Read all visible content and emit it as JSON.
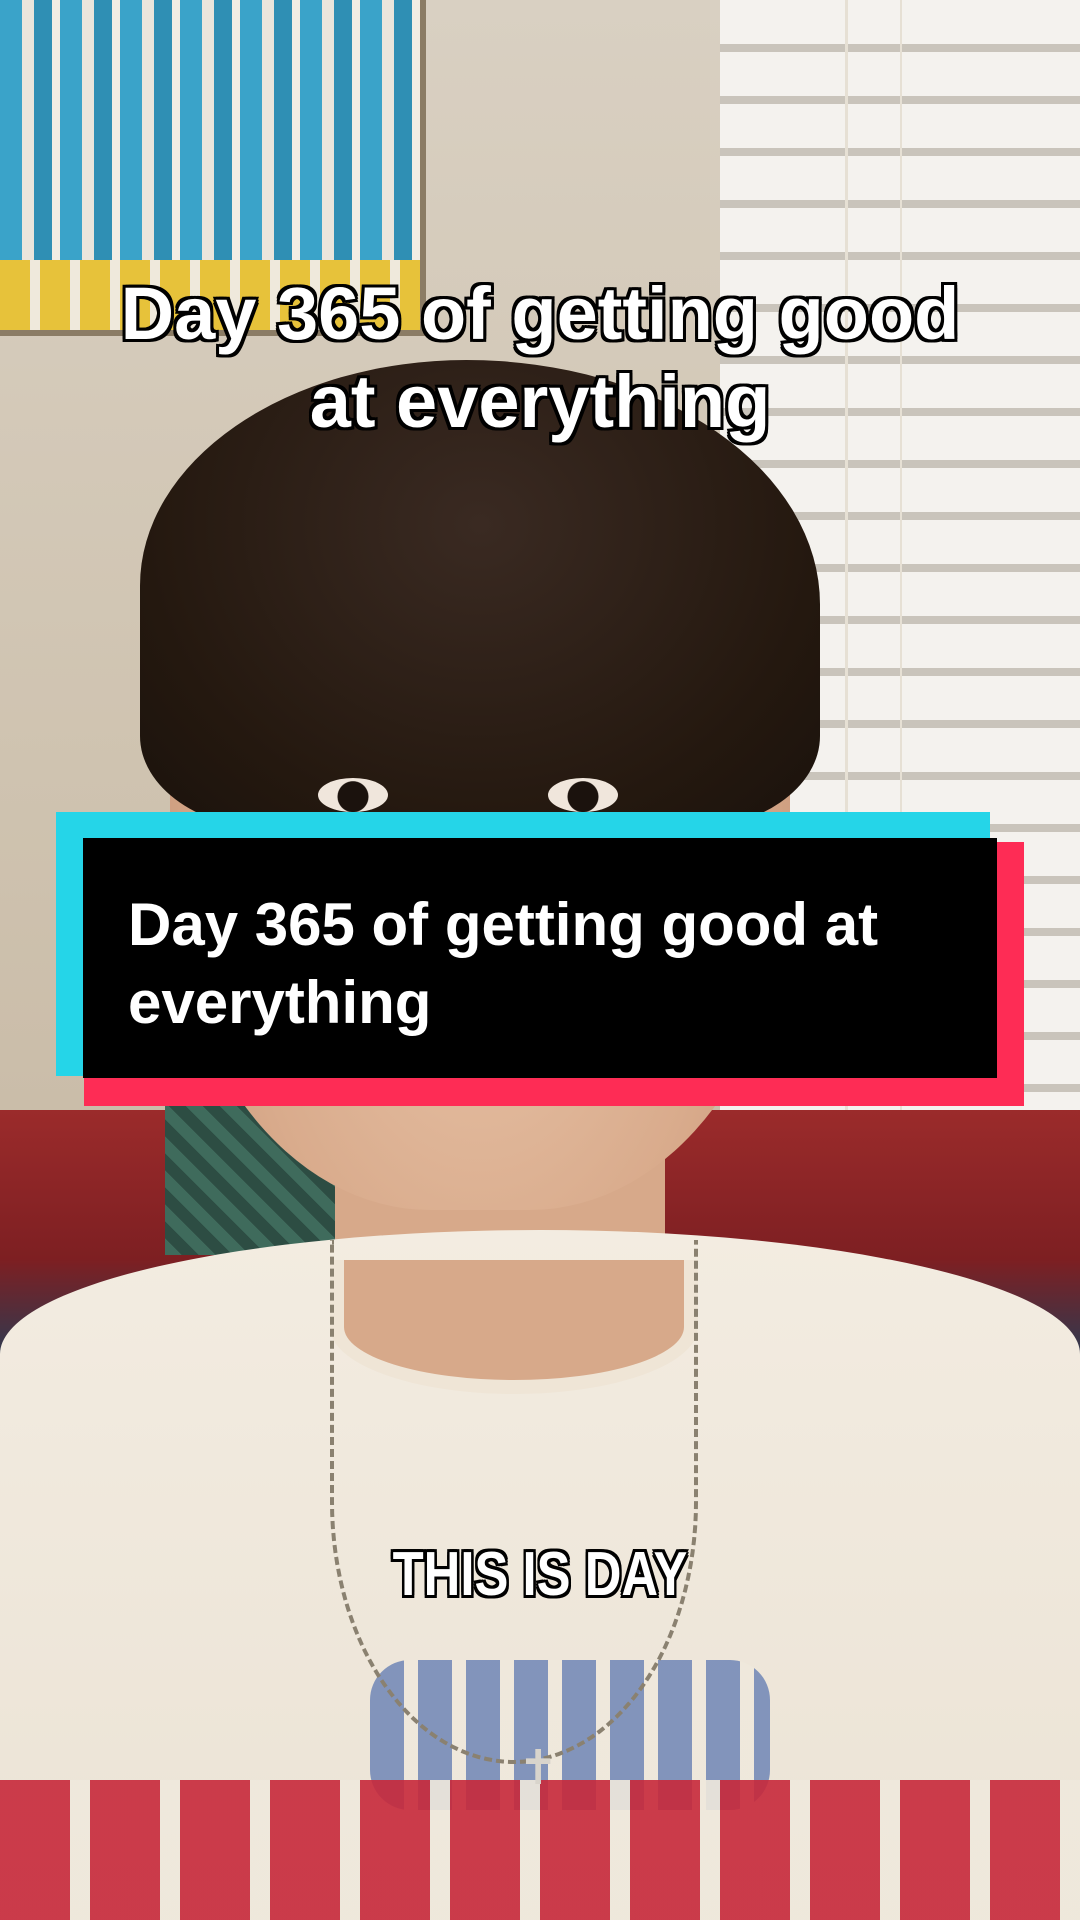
{
  "video": {
    "title_overlay": {
      "line1": "Day 365 of getting good",
      "line2": "at everything"
    },
    "card": {
      "text": "Day 365 of getting good at everything",
      "colors": {
        "accent_left": "#25d5e8",
        "accent_right": "#fe2c55",
        "background": "#000000",
        "text": "#ffffff"
      }
    },
    "caption": "THIS IS DAY"
  }
}
